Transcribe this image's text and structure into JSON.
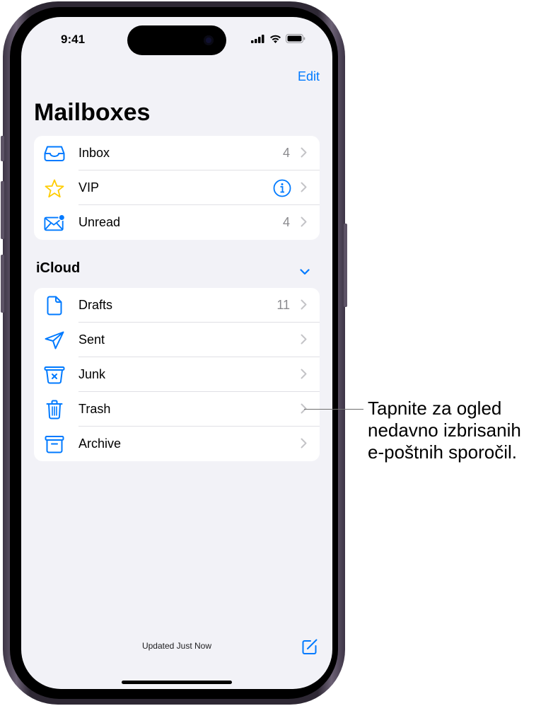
{
  "status_bar": {
    "time": "9:41",
    "icons": [
      "cellular-signal-icon",
      "wifi-icon",
      "battery-icon"
    ]
  },
  "nav": {
    "edit_label": "Edit",
    "title": "Mailboxes"
  },
  "mailboxes": [
    {
      "label": "Inbox",
      "icon": "inbox-tray-icon",
      "count": "4",
      "icon_color": "#007aff"
    },
    {
      "label": "VIP",
      "icon": "star-icon",
      "count": null,
      "info_icon": "info-circle-icon",
      "icon_color": "#ffcc00"
    },
    {
      "label": "Unread",
      "icon": "envelope-unread-icon",
      "count": "4",
      "icon_color": "#007aff"
    }
  ],
  "icloud": {
    "header": "iCloud",
    "collapse_icon": "chevron-down-icon",
    "items": [
      {
        "label": "Drafts",
        "icon": "document-icon",
        "count": "11"
      },
      {
        "label": "Sent",
        "icon": "paper-plane-icon",
        "count": null
      },
      {
        "label": "Junk",
        "icon": "junk-bin-icon",
        "count": null
      },
      {
        "label": "Trash",
        "icon": "trash-icon",
        "count": null
      },
      {
        "label": "Archive",
        "icon": "archive-box-icon",
        "count": null
      }
    ]
  },
  "footer": {
    "status_text": "Updated Just Now",
    "compose_icon": "compose-icon"
  },
  "callout": {
    "lines": [
      "Tapnite za ogled",
      "nedavno izbrisanih",
      "e-poštnih sporočil."
    ],
    "target": "Trash"
  },
  "colors": {
    "accent": "#007aff",
    "background": "#f2f2f7",
    "star": "#ffcc00",
    "secondary_text": "#8a8a8e"
  }
}
